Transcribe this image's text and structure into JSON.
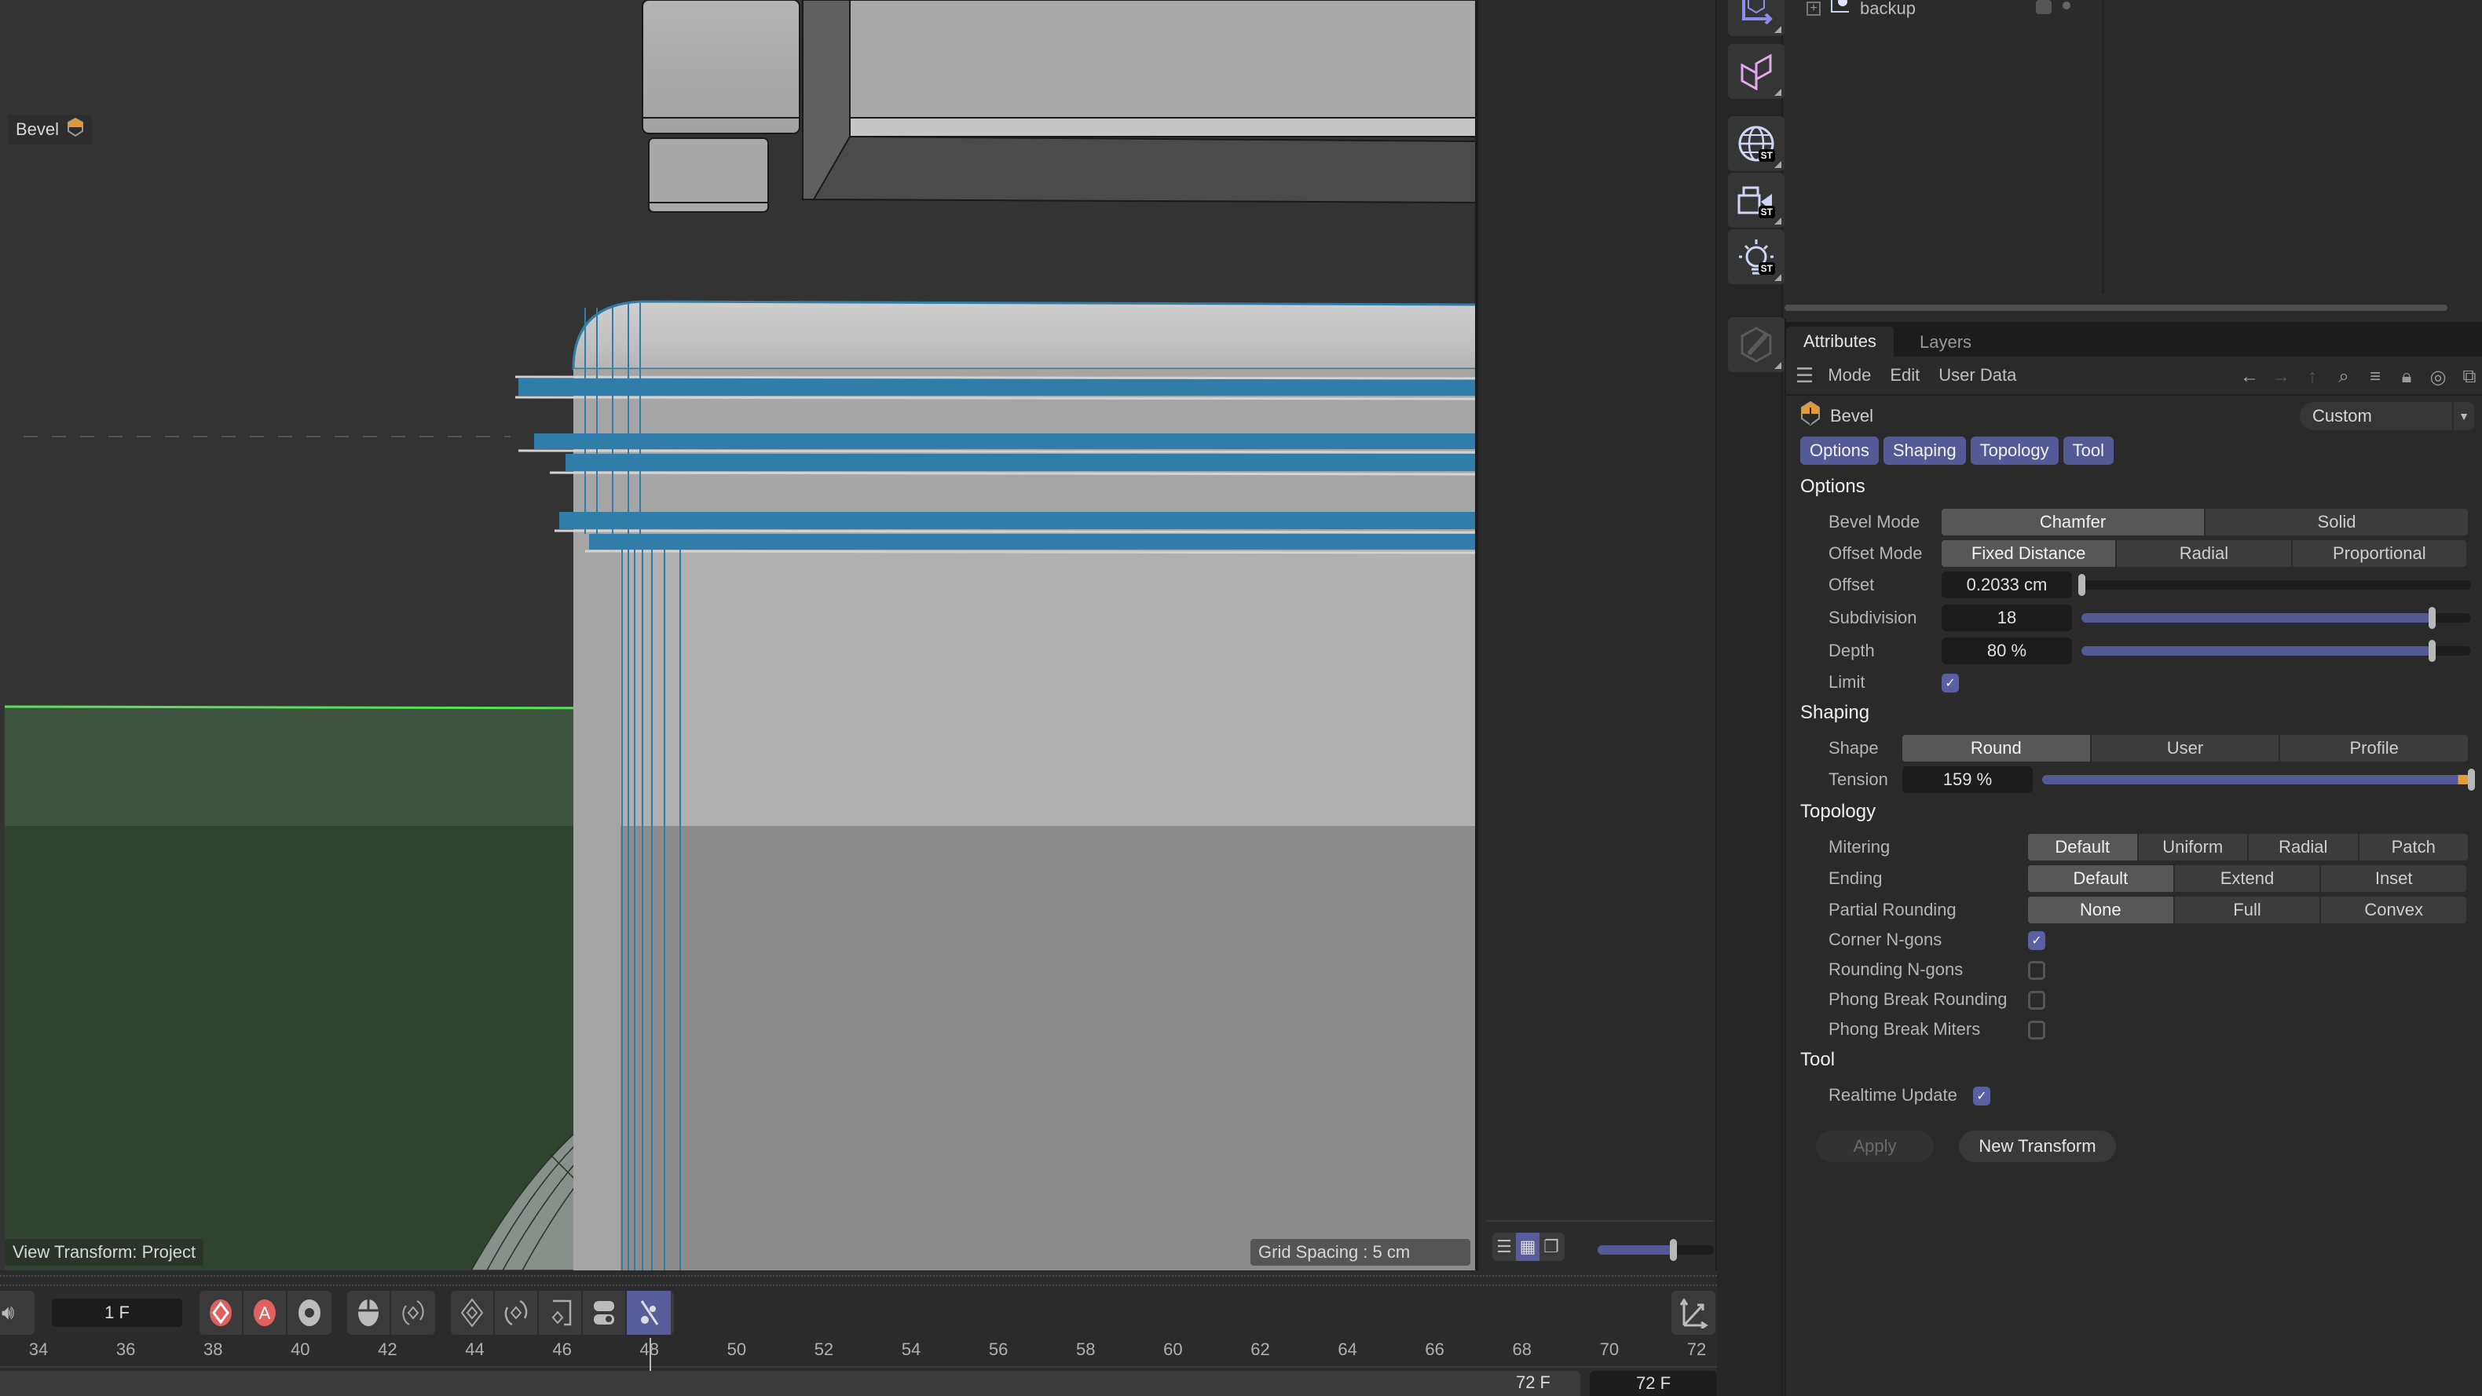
{
  "viewport": {
    "object_label": "Bevel",
    "view_transform": "View Transform: Project",
    "grid_spacing": "Grid Spacing : 5 cm",
    "view_modes": [
      "list",
      "grid",
      "single"
    ],
    "view_mode_active": "grid",
    "thumbnail_size_fraction": 0.65
  },
  "timeline": {
    "current_frame": "1 F",
    "ruler_labels": [
      "34",
      "36",
      "38",
      "40",
      "42",
      "44",
      "46",
      "48",
      "50",
      "52",
      "54",
      "56",
      "58",
      "60",
      "62",
      "64",
      "66",
      "68",
      "70",
      "72"
    ],
    "playhead_frame": 48,
    "range_end": "72 F",
    "end_field": "72 F",
    "tools": {
      "group1": [
        "record-keyframe",
        "autokey",
        "keyframe-settings"
      ],
      "group2": [
        "mouse-interaction",
        "animate-selection"
      ],
      "group3": [
        "keyframe-position",
        "keyframe-rotation",
        "keyframe-scale",
        "keyframe-parameters",
        "keyframe-pla"
      ],
      "active_tool": "keyframe-pla"
    }
  },
  "tool_strip": {
    "items": [
      "coordinate-system",
      "symmetry",
      "sky-st",
      "camera-st",
      "light-st",
      "edit-tool"
    ],
    "badge": "ST"
  },
  "object_manager": {
    "rows": [
      {
        "name": "backup"
      }
    ]
  },
  "attributes": {
    "tabs": [
      {
        "label": "Attributes",
        "active": true
      },
      {
        "label": "Layers",
        "active": false
      }
    ],
    "menu": [
      "Mode",
      "Edit",
      "User Data"
    ],
    "object_name": "Bevel",
    "preset": "Custom",
    "group_tabs": [
      "Options",
      "Shaping",
      "Topology",
      "Tool"
    ],
    "options": {
      "title": "Options",
      "bevel_mode": {
        "label": "Bevel Mode",
        "options": [
          "Chamfer",
          "Solid"
        ],
        "selected": "Chamfer"
      },
      "offset_mode": {
        "label": "Offset Mode",
        "options": [
          "Fixed Distance",
          "Radial",
          "Proportional"
        ],
        "selected": "Fixed Distance"
      },
      "offset": {
        "label": "Offset",
        "value": "0.2033 cm",
        "slider_fraction": 0.0
      },
      "subdivision": {
        "label": "Subdivision",
        "value": "18",
        "slider_fraction": 0.9
      },
      "depth": {
        "label": "Depth",
        "value": "80 %",
        "slider_fraction": 0.9
      },
      "limit": {
        "label": "Limit",
        "checked": true
      }
    },
    "shaping": {
      "title": "Shaping",
      "shape": {
        "label": "Shape",
        "options": [
          "Round",
          "User",
          "Profile"
        ],
        "selected": "Round"
      },
      "tension": {
        "label": "Tension",
        "value": "159 %",
        "slider_fraction": 1.0
      }
    },
    "topology": {
      "title": "Topology",
      "mitering": {
        "label": "Mitering",
        "options": [
          "Default",
          "Uniform",
          "Radial",
          "Patch"
        ],
        "selected": "Default"
      },
      "ending": {
        "label": "Ending",
        "options": [
          "Default",
          "Extend",
          "Inset"
        ],
        "selected": "Default"
      },
      "partial_rounding": {
        "label": "Partial Rounding",
        "options": [
          "None",
          "Full",
          "Convex"
        ],
        "selected": "None"
      },
      "corner_ngons": {
        "label": "Corner N-gons",
        "checked": true
      },
      "rounding_ngons": {
        "label": "Rounding N-gons",
        "checked": false
      },
      "phong_break_rounding": {
        "label": "Phong Break Rounding",
        "checked": false
      },
      "phong_break_miters": {
        "label": "Phong Break Miters",
        "checked": false
      }
    },
    "tool": {
      "title": "Tool",
      "realtime_update": {
        "label": "Realtime Update",
        "checked": true
      },
      "apply_label": "Apply",
      "new_transform_label": "New Transform"
    }
  },
  "colors": {
    "accent": "#545a96",
    "selection_blue": "#2f7da8",
    "autokey_red": "#e06060",
    "bevel_orange": "#e39a3c",
    "ground_green": "#2f4330"
  }
}
